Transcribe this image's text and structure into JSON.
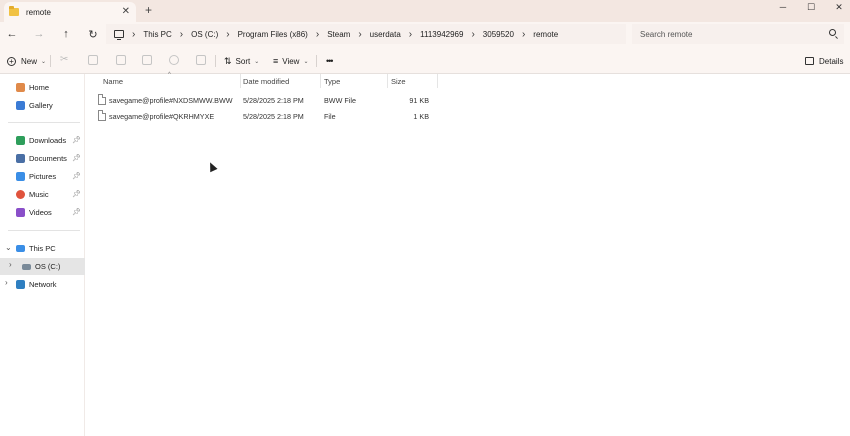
{
  "window": {
    "tab_title": "remote",
    "new_tab": "+",
    "tab_close": "✕",
    "controls": {
      "minimize": "─",
      "maximize": "☐",
      "close": "✕"
    }
  },
  "address": {
    "breadcrumbs": [
      "This PC",
      "OS (C:)",
      "Program Files (x86)",
      "Steam",
      "userdata",
      "1113942969",
      "3059520",
      "remote"
    ],
    "search_placeholder": "Search remote"
  },
  "toolbar": {
    "new_label": "New",
    "sort_label": "Sort",
    "view_label": "View",
    "more_label": "•••",
    "details_label": "Details"
  },
  "sidebar": {
    "quick": [
      {
        "label": "Home",
        "icon": "home-icon",
        "color": "#e08a4a"
      },
      {
        "label": "Gallery",
        "icon": "gallery-icon",
        "color": "#3a7bd5"
      }
    ],
    "pinned": [
      {
        "label": "Downloads",
        "icon": "downloads-icon",
        "color": "#2e9e5b"
      },
      {
        "label": "Documents",
        "icon": "documents-icon",
        "color": "#4a6fa5"
      },
      {
        "label": "Pictures",
        "icon": "pictures-icon",
        "color": "#3a8ee6"
      },
      {
        "label": "Music",
        "icon": "music-icon",
        "color": "#e0533d"
      },
      {
        "label": "Videos",
        "icon": "videos-icon",
        "color": "#8a4fc9"
      }
    ],
    "this_pc": "This PC",
    "os_drive": "OS (C:)",
    "network": "Network"
  },
  "columns": {
    "name": "Name",
    "date": "Date modified",
    "type": "Type",
    "size": "Size"
  },
  "files": [
    {
      "name": "savegame@profile#NXDSMWW.BWW",
      "date": "5/28/2025 2:18 PM",
      "type": "BWW File",
      "size": "91 KB"
    },
    {
      "name": "savegame@profile#QKRHMYXE",
      "date": "5/28/2025 2:18 PM",
      "type": "File",
      "size": "1 KB"
    }
  ]
}
